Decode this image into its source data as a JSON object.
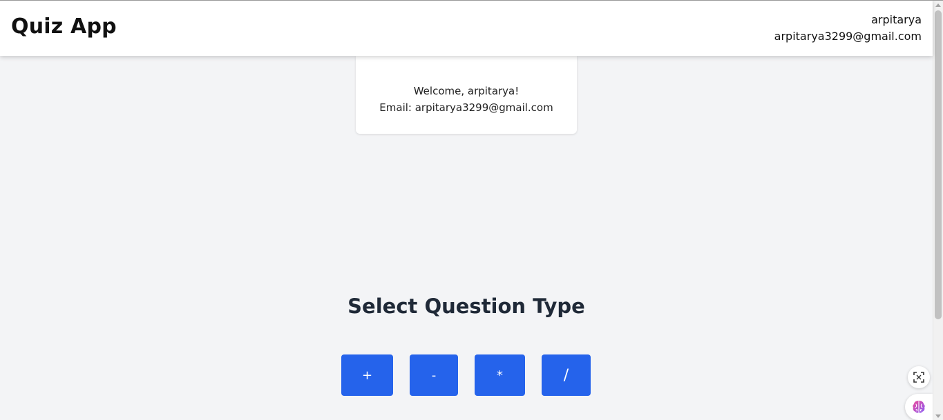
{
  "navbar": {
    "title": "Quiz App",
    "username": "arpitarya",
    "email": "arpitarya3299@gmail.com"
  },
  "welcome": {
    "greeting": "Welcome, arpitarya!",
    "email_line": "Email: arpitarya3299@gmail.com"
  },
  "quiz": {
    "heading": "Select Question Type",
    "operations": [
      {
        "label": "+"
      },
      {
        "label": "-"
      },
      {
        "label": "*"
      },
      {
        "label": "/"
      }
    ]
  },
  "floating": {
    "scan_icon": "scan-icon",
    "brain_icon": "brain-icon"
  },
  "colors": {
    "accent": "#2563eb",
    "background": "#f3f4f6",
    "heading": "#1f2937"
  }
}
